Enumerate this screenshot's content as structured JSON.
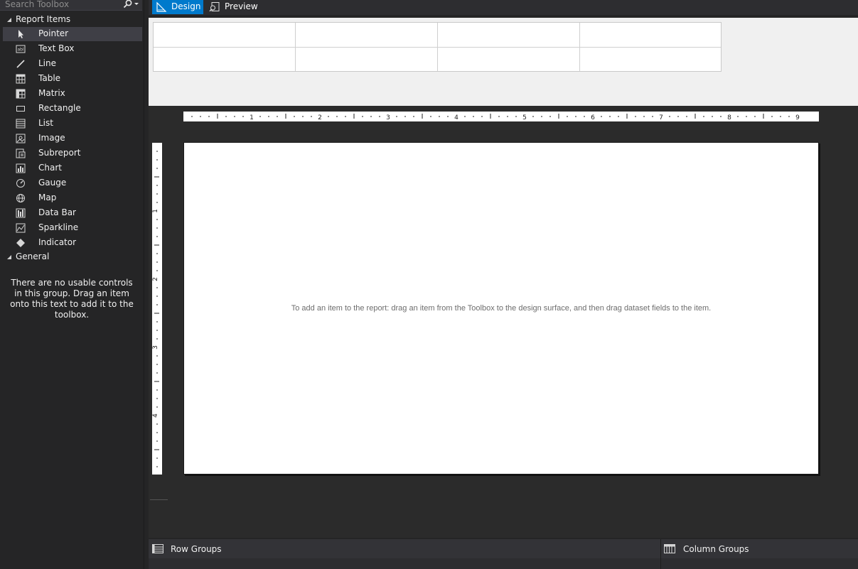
{
  "toolbox": {
    "search_placeholder": "Search Toolbox",
    "report_items_header": "Report Items",
    "items": [
      {
        "label": "Pointer",
        "icon": "pointer-icon",
        "selected": true
      },
      {
        "label": "Text Box",
        "icon": "textbox-icon"
      },
      {
        "label": "Line",
        "icon": "line-icon"
      },
      {
        "label": "Table",
        "icon": "table-icon"
      },
      {
        "label": "Matrix",
        "icon": "matrix-icon"
      },
      {
        "label": "Rectangle",
        "icon": "rectangle-icon"
      },
      {
        "label": "List",
        "icon": "list-icon"
      },
      {
        "label": "Image",
        "icon": "image-icon"
      },
      {
        "label": "Subreport",
        "icon": "subreport-icon"
      },
      {
        "label": "Chart",
        "icon": "chart-icon"
      },
      {
        "label": "Gauge",
        "icon": "gauge-icon"
      },
      {
        "label": "Map",
        "icon": "map-icon"
      },
      {
        "label": "Data Bar",
        "icon": "data-bar-icon"
      },
      {
        "label": "Sparkline",
        "icon": "sparkline-icon"
      },
      {
        "label": "Indicator",
        "icon": "indicator-icon"
      }
    ],
    "general_header": "General",
    "general_empty_text": "There are no usable controls in this group. Drag an item onto this text to add it to the toolbox."
  },
  "tabs": {
    "design": "Design",
    "preview": "Preview",
    "active": "design"
  },
  "ruler": {
    "h_labels": [
      "1",
      "2",
      "3",
      "4",
      "5",
      "6",
      "7",
      "8",
      "9"
    ],
    "v_labels": [
      "1",
      "2",
      "3",
      "4"
    ]
  },
  "design_surface": {
    "hint": "To add an item to the report: drag an item from the Toolbox to the design surface, and then drag dataset fields to the item."
  },
  "groups": {
    "row_groups": "Row Groups",
    "column_groups": "Column Groups"
  },
  "colors": {
    "accent": "#007acc",
    "toolbox_bg": "#252526",
    "page_bg": "#ffffff"
  }
}
